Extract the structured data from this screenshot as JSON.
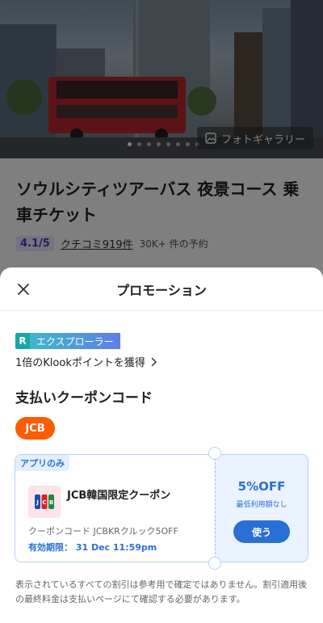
{
  "product": {
    "gallery_label": "フォトギャラリー",
    "title": "ソウルシティツアーバス 夜景コース 乗車チケット",
    "rating": "4.1/5",
    "reviews": "クチコミ919件",
    "booked": "30K+ 件の予約",
    "carousel_dots": 8,
    "active_dot": 1
  },
  "sheet": {
    "title": "プロモーション",
    "explorer_logo": "R",
    "explorer_label": "エクスプローラー",
    "points_link": "1倍のKlookポイントを獲得",
    "coupon_heading": "支払いクーポンコード",
    "chip": "JCB",
    "coupon": {
      "tag": "アプリのみ",
      "name": "JCB韓国限定クーポン",
      "code": "クーポンコード JCBKRクルック5OFF",
      "expiry": "有効期限： 31 Dec 11:59pm",
      "discount": "5%OFF",
      "min_spend": "最低利用額なし",
      "use_button": "使う"
    },
    "disclaimer": "表示されているすべての割引は参考用で確定ではありません。割引適用後の最終料金は支払いページにて確認する必要があります。"
  },
  "colors": {
    "accent_blue": "#2a6fd6",
    "jcb_orange": "#ff5b00",
    "overlay": "rgba(0,0,0,0.5)"
  }
}
